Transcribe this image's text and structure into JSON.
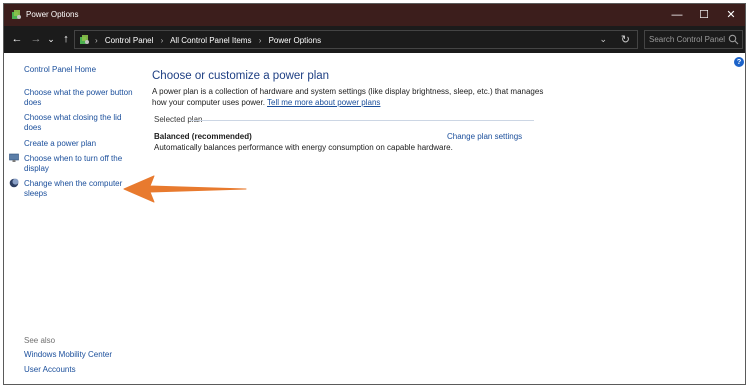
{
  "window": {
    "title": "Power Options",
    "controls": {
      "minimize": "—",
      "maximize": "☐",
      "close": "✕"
    }
  },
  "address_bar": {
    "back": "←",
    "forward": "→",
    "recent": "⌄",
    "up": "↑",
    "breadcrumbs": [
      "Control Panel",
      "All Control Panel Items",
      "Power Options"
    ],
    "separator": "›",
    "dropdown": "⌄",
    "refresh": "↻",
    "search_placeholder": "Search Control Panel"
  },
  "sidebar": {
    "home": "Control Panel Home",
    "links": [
      "Choose what the power button does",
      "Choose what closing the lid does",
      "Create a power plan",
      "Choose when to turn off the display",
      "Change when the computer sleeps"
    ],
    "see_also_label": "See also",
    "see_also": [
      "Windows Mobility Center",
      "User Accounts"
    ]
  },
  "main": {
    "heading": "Choose or customize a power plan",
    "description": "A power plan is a collection of hardware and system settings (like display brightness, sleep, etc.) that manages how your computer uses power.",
    "learn_more": "Tell me more about power plans",
    "selected_plan_label": "Selected plan",
    "plan": {
      "name": "Balanced (recommended)",
      "change_link": "Change plan settings",
      "description": "Automatically balances performance with energy consumption on capable hardware."
    }
  },
  "help": "?",
  "colors": {
    "titlebar": "#3c1e1c",
    "addressbar": "#1b1b1b",
    "link": "#1a4e9b",
    "heading": "#1e3f83",
    "annotation_arrow": "#e87a2e"
  }
}
